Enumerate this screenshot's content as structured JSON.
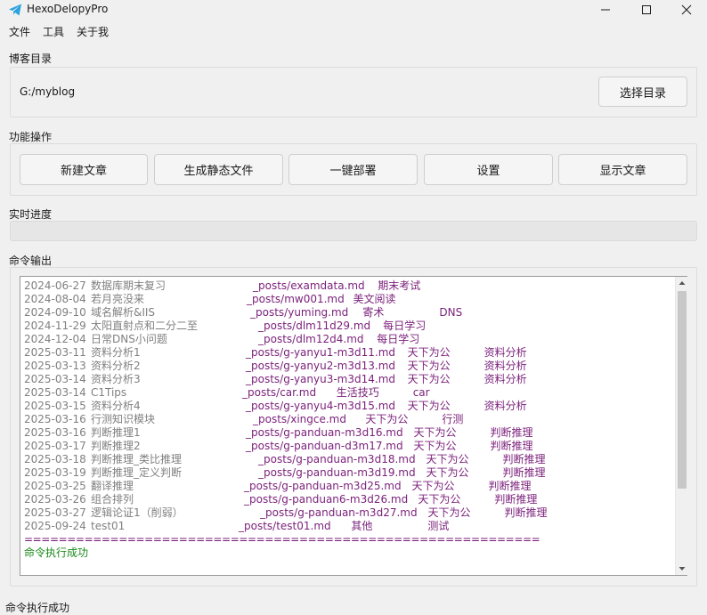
{
  "window": {
    "title": "HexoDelopyPro",
    "icon": "telegram-paper-plane-icon",
    "controls": [
      "minimize-icon",
      "maximize-icon",
      "close-icon"
    ]
  },
  "menu": {
    "file": "文件",
    "tools": "工具",
    "about": "关于我"
  },
  "blog_dir": {
    "label": "博客目录",
    "path": "G:/myblog",
    "select_button": "选择目录"
  },
  "actions": {
    "label": "功能操作",
    "new_post": "新建文章",
    "generate": "生成静态文件",
    "deploy": "一键部署",
    "settings": "设置",
    "show_posts": "显示文章"
  },
  "progress": {
    "label": "实时进度",
    "value": 0
  },
  "output": {
    "label": "命令输出",
    "rows": [
      {
        "date": "2024-06-27",
        "title": "数据库期末复习",
        "path": "_posts/examdata.md",
        "category": "期末考试",
        "tag": ""
      },
      {
        "date": "2024-08-04",
        "title": "若月亮没来",
        "path": "_posts/mw001.md",
        "category": "美文阅读",
        "tag": ""
      },
      {
        "date": "2024-09-10",
        "title": "域名解析&IIS",
        "path": "_posts/yuming.md",
        "category": "寄术",
        "tag": "DNS"
      },
      {
        "date": "2024-11-29",
        "title": "太阳直射点和二分二至",
        "path": "_posts/dlm11d29.md",
        "category": "每日学习",
        "tag": ""
      },
      {
        "date": "2024-12-04",
        "title": "日常DNS小问题",
        "path": "_posts/dlm12d4.md",
        "category": "每日学习",
        "tag": ""
      },
      {
        "date": "2025-03-11",
        "title": "资料分析1",
        "path": "_posts/g-yanyu1-m3d11.md",
        "category": "天下为公",
        "tag": "资料分析"
      },
      {
        "date": "2025-03-13",
        "title": "资料分析2",
        "path": "_posts/g-yanyu2-m3d13.md",
        "category": "天下为公",
        "tag": "资料分析"
      },
      {
        "date": "2025-03-14",
        "title": "资料分析3",
        "path": "_posts/g-yanyu3-m3d14.md",
        "category": "天下为公",
        "tag": "资料分析"
      },
      {
        "date": "2025-03-14",
        "title": "C1Tips",
        "path": "_posts/car.md",
        "category": "生活技巧",
        "tag": "car"
      },
      {
        "date": "2025-03-15",
        "title": "资料分析4",
        "path": "_posts/g-yanyu4-m3d15.md",
        "category": "天下为公",
        "tag": "资料分析"
      },
      {
        "date": "2025-03-16",
        "title": "行测知识模块",
        "path": "_posts/xingce.md",
        "category": "天下为公",
        "tag": "行测"
      },
      {
        "date": "2025-03-16",
        "title": "判断推理1",
        "path": "_posts/g-panduan-m3d16.md",
        "category": "天下为公",
        "tag": "判断推理"
      },
      {
        "date": "2025-03-17",
        "title": "判断推理2",
        "path": "_posts/g-panduan-d3m17.md",
        "category": "天下为公",
        "tag": "判断推理"
      },
      {
        "date": "2025-03-18",
        "title": "判断推理_类比推理",
        "path": "_posts/g-panduan-m3d18.md",
        "category": "天下为公",
        "tag": "判断推理"
      },
      {
        "date": "2025-03-19",
        "title": "判断推理_定义判断",
        "path": "_posts/g-panduan-m3d19.md",
        "category": "天下为公",
        "tag": "判断推理"
      },
      {
        "date": "2025-03-25",
        "title": "翻译推理",
        "path": "_posts/g-panduan-m3d25.md",
        "category": "天下为公",
        "tag": "判断推理"
      },
      {
        "date": "2025-03-26",
        "title": "组合排列",
        "path": "_posts/g-panduan6-m3d26.md",
        "category": "天下为公",
        "tag": "判断推理"
      },
      {
        "date": "2025-03-27",
        "title": "逻辑论证1（削弱）",
        "path": "_posts/g-panduan-m3d27.md",
        "category": "天下为公",
        "tag": "判断推理"
      },
      {
        "date": "2025-09-24",
        "title": "test01",
        "path": "_posts/test01.md",
        "category": "其他",
        "tag": "测试"
      }
    ],
    "separator": "============================================================",
    "result": "命令执行成功"
  },
  "status_bar": {
    "text": "命令执行成功"
  },
  "colors": {
    "background": "#f0f0f0",
    "console_meta": "#808080",
    "console_path": "#7a1f7a",
    "success": "#1a8a1a",
    "app_icon": "#2aa3e0"
  }
}
